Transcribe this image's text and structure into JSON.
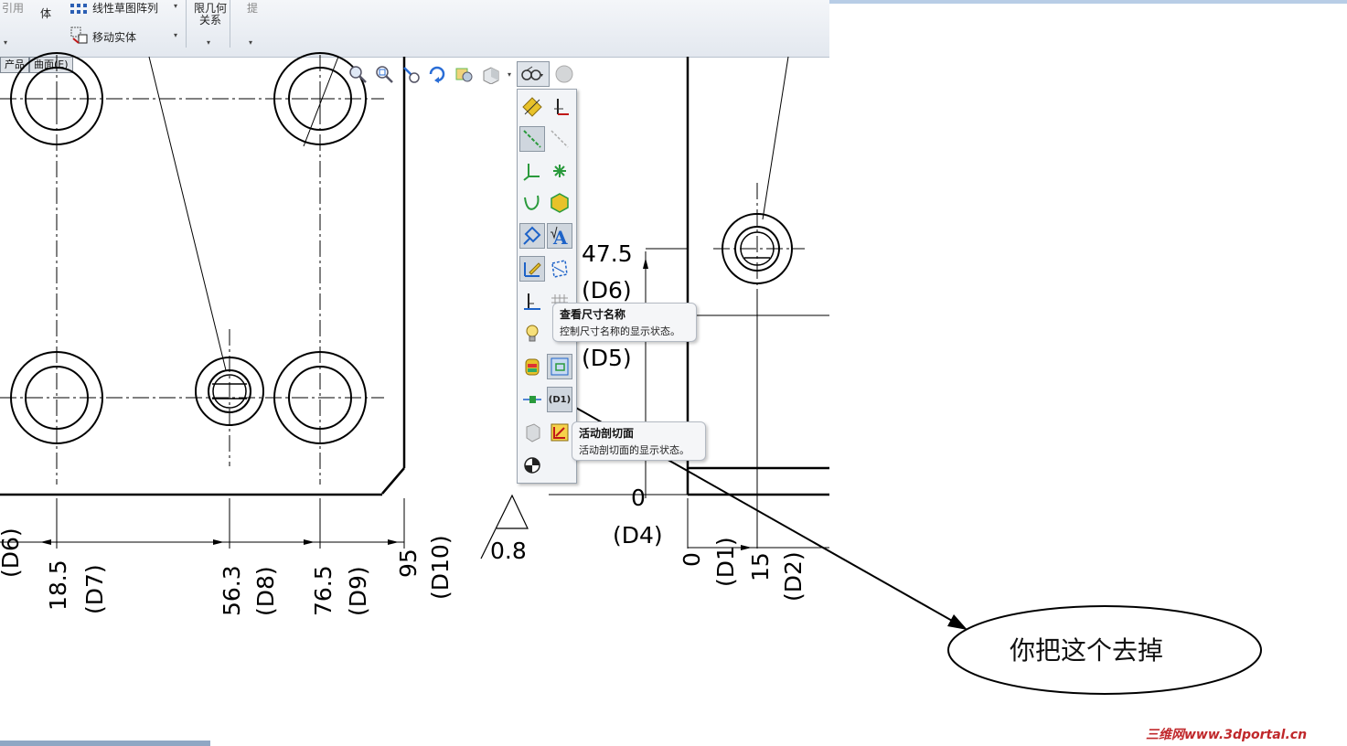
{
  "ribbon": {
    "items": {
      "ref_label": "引用",
      "body_label": "体",
      "linear_pattern": "线性草图阵列",
      "move_entity": "移动实体",
      "relations_line1": "限几何",
      "relations_line2": "关系",
      "extra_label": "提"
    },
    "tabs": [
      "产品",
      "曲面(E)"
    ]
  },
  "hud": {
    "icons": [
      "zoom-to-fit-icon",
      "zoom-area-icon",
      "previous-view-icon",
      "rotate-icon",
      "pan-icon",
      "view-orientation-icon",
      "display-style-icon",
      "hide-show-items-icon",
      "appearance-icon"
    ]
  },
  "flyout": {
    "selected_dim_label": "(D1)"
  },
  "tooltips": {
    "dim_names_title": "查看尺寸名称",
    "dim_names_desc": "控制尺寸名称的显示状态。",
    "section_title": "活动剖切面",
    "section_desc": "活动剖切面的显示状态。"
  },
  "drawing": {
    "dims": {
      "d6_value": "47.5",
      "d6_name": "(D6)",
      "d5_name": "(D5)",
      "d4_value": "0",
      "d4_name": "(D4)",
      "d6_left": "(D6)",
      "d7_value": "18.5",
      "d7_name": "(D7)",
      "d8_value": "56.3",
      "d8_name": "(D8)",
      "d9_value": "76.5",
      "d9_name": "(D9)",
      "d10_value": "95",
      "d10_name": "(D10)",
      "roughness": "0.8",
      "d1_value": "0",
      "d1_name": "(D1)",
      "d2_value": "15",
      "d2_name": "(D2)"
    }
  },
  "annotation": {
    "note_text": "你把这个去掉"
  },
  "watermark": "三维网www.3dportal.cn",
  "colors": {
    "ribbon_bg": "#e8ecf1",
    "accent_yellow": "#e8c22a",
    "accent_blue": "#1e63c8",
    "accent_green": "#2a9a3c",
    "watermark_red": "#c0282b"
  }
}
